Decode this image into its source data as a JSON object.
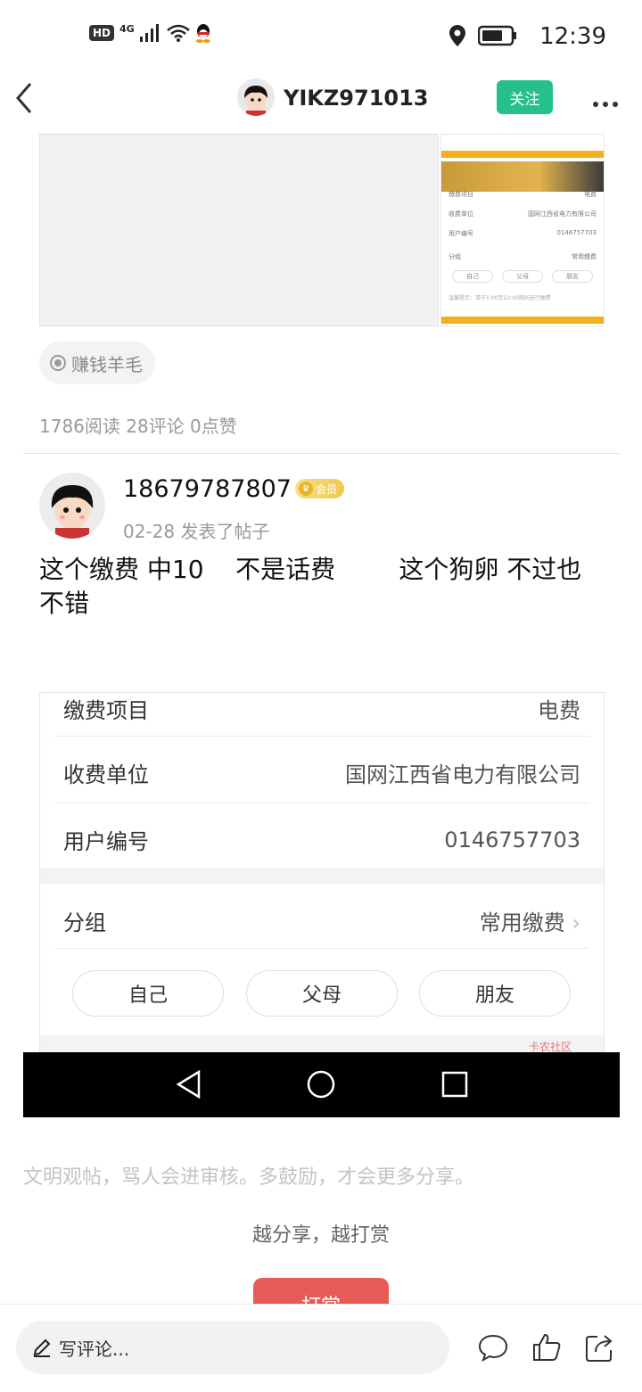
{
  "status_bar": {
    "hd": "HD",
    "network": "4G",
    "time": "12:39",
    "icons": [
      "hd-icon",
      "signal-icon",
      "wifi-icon",
      "qq-icon",
      "location-icon",
      "battery-icon"
    ]
  },
  "header": {
    "back_icon": "back-icon",
    "username": "YIKZ971013",
    "follow_label": "关注",
    "more_icon": "more-icon"
  },
  "post": {
    "thumb": {
      "rows": [
        {
          "k": "缴费项目",
          "v": "电费"
        },
        {
          "k": "收费单位",
          "v": "国网江西省电力有限公司"
        },
        {
          "k": "用户编号",
          "v": "0146757703"
        }
      ],
      "group_label": "分组",
      "group_value": "常用缴费",
      "pills": [
        "自己",
        "父母",
        "朋友"
      ],
      "note": "温馨提示：请于1:00至23:00期间进行缴费"
    },
    "tag": "赚钱羊毛",
    "stats": "1786阅读 28评论 0点赞"
  },
  "comment": {
    "name": "18679787807",
    "badge": "会员",
    "meta": "02-28  发表了帖子",
    "content": "这个缴费 中10    不是话费        这个狗卵 不过也不错"
  },
  "screenshot": {
    "rows": [
      {
        "k": "缴费项目",
        "v": "电费"
      },
      {
        "k": "收费单位",
        "v": "国网江西省电力有限公司"
      },
      {
        "k": "用户编号",
        "v": "0146757703"
      }
    ],
    "group_label": "分组",
    "group_value": "常用缴费",
    "pills": [
      "自己",
      "父母",
      "朋友"
    ],
    "watermark": "卡农社区"
  },
  "footer": {
    "notice": "文明观帖，骂人会进审核。多鼓励，才会更多分享。",
    "reward_text": "越分享，越打赏",
    "reward_button": "打赏"
  },
  "bottom_bar": {
    "comment_placeholder": "写评论...",
    "icons": [
      "comment-icon",
      "like-icon",
      "share-icon"
    ]
  }
}
